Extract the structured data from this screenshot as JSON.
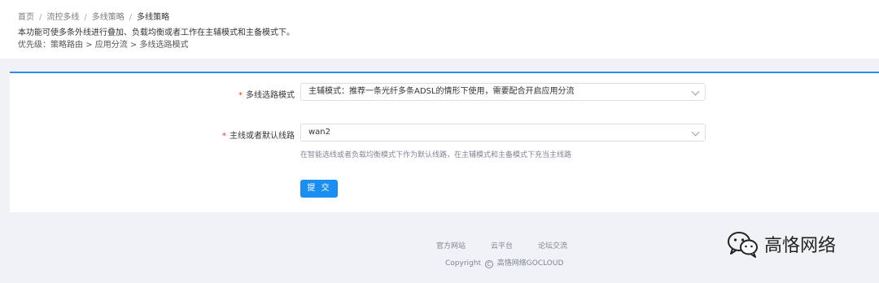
{
  "breadcrumb": {
    "items": [
      "首页",
      "流控多线",
      "多线策略"
    ],
    "current": "多线策略",
    "separator": "/"
  },
  "description": "本功能可使多条外线进行叠加、负载均衡或者工作在主辅模式和主备模式下。",
  "priority": "优先级：策略路由 > 应用分流 > 多线选路模式",
  "form": {
    "mode_label": "多线选路模式",
    "mode_value": "主辅模式：推荐一条光纤多条ADSL的情形下使用，需要配合开启应用分流",
    "line_label": "主线或者默认线路",
    "line_value": "wan2",
    "line_hint": "在智能选线或者负载均衡模式下作为默认线路，在主辅模式和主备模式下充当主线路",
    "required_mark": "*",
    "submit_label": "提 交"
  },
  "footer": {
    "links": [
      "官方网站",
      "云平台",
      "论坛交流"
    ],
    "copyright_prefix": "Copyright",
    "copyright_symbol": "C",
    "copyright_owner": "高恪网络GOCLOUD"
  },
  "watermark": {
    "text": "高恪网络",
    "icon": "wechat-icon"
  },
  "colors": {
    "accent": "#2e8ff0",
    "button": "#1b8ef2",
    "required": "#ed4014"
  }
}
